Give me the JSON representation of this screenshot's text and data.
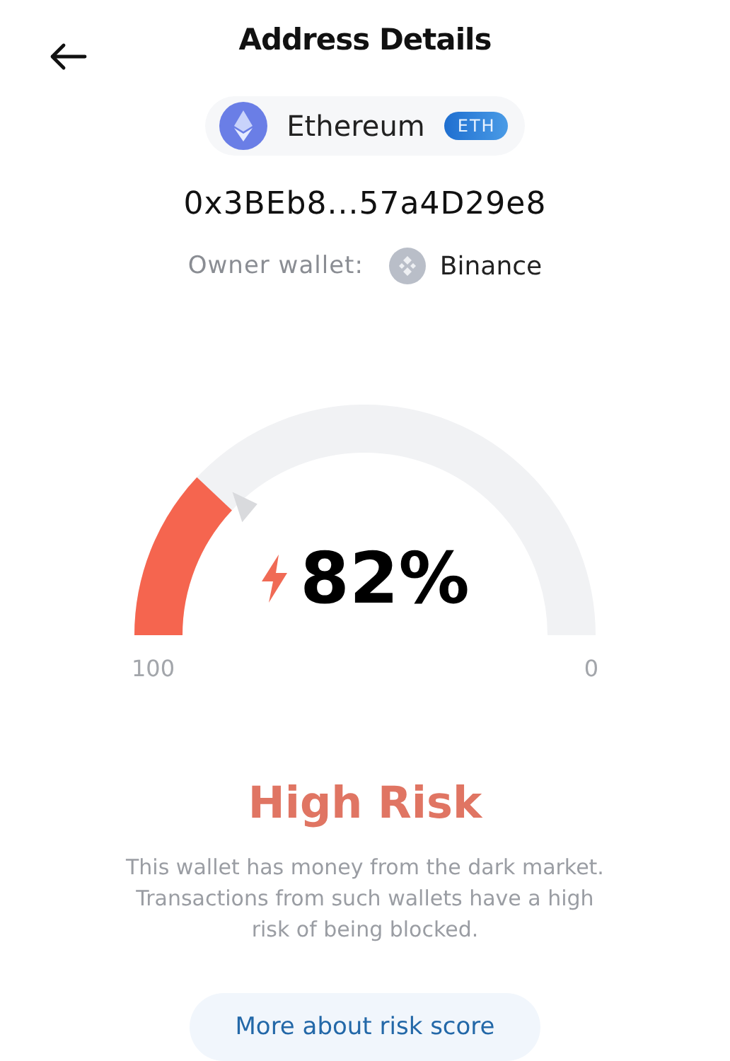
{
  "header": {
    "title": "Address Details"
  },
  "network": {
    "name": "Ethereum",
    "ticker": "ETH"
  },
  "address": "0x3BEb8...57a4D29e8",
  "owner": {
    "label": "Owner wallet:",
    "name": "Binance"
  },
  "gauge": {
    "value": "82%",
    "min_label": "100",
    "max_label": "0"
  },
  "risk": {
    "title": "High Risk",
    "description": "This wallet has money from the dark market. Transactions from such wallets have a high risk of being blocked."
  },
  "button": "More about risk score"
}
